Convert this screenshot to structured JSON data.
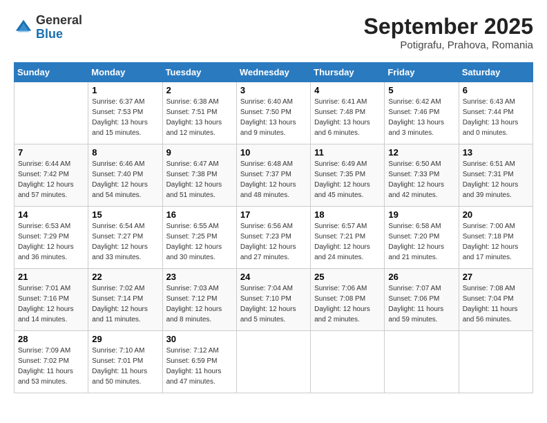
{
  "logo": {
    "general": "General",
    "blue": "Blue"
  },
  "title": "September 2025",
  "subtitle": "Potigrafu, Prahova, Romania",
  "days_header": [
    "Sunday",
    "Monday",
    "Tuesday",
    "Wednesday",
    "Thursday",
    "Friday",
    "Saturday"
  ],
  "weeks": [
    [
      {
        "day": "",
        "sunrise": "",
        "sunset": "",
        "daylight": ""
      },
      {
        "day": "1",
        "sunrise": "Sunrise: 6:37 AM",
        "sunset": "Sunset: 7:53 PM",
        "daylight": "Daylight: 13 hours and 15 minutes."
      },
      {
        "day": "2",
        "sunrise": "Sunrise: 6:38 AM",
        "sunset": "Sunset: 7:51 PM",
        "daylight": "Daylight: 13 hours and 12 minutes."
      },
      {
        "day": "3",
        "sunrise": "Sunrise: 6:40 AM",
        "sunset": "Sunset: 7:50 PM",
        "daylight": "Daylight: 13 hours and 9 minutes."
      },
      {
        "day": "4",
        "sunrise": "Sunrise: 6:41 AM",
        "sunset": "Sunset: 7:48 PM",
        "daylight": "Daylight: 13 hours and 6 minutes."
      },
      {
        "day": "5",
        "sunrise": "Sunrise: 6:42 AM",
        "sunset": "Sunset: 7:46 PM",
        "daylight": "Daylight: 13 hours and 3 minutes."
      },
      {
        "day": "6",
        "sunrise": "Sunrise: 6:43 AM",
        "sunset": "Sunset: 7:44 PM",
        "daylight": "Daylight: 13 hours and 0 minutes."
      }
    ],
    [
      {
        "day": "7",
        "sunrise": "Sunrise: 6:44 AM",
        "sunset": "Sunset: 7:42 PM",
        "daylight": "Daylight: 12 hours and 57 minutes."
      },
      {
        "day": "8",
        "sunrise": "Sunrise: 6:46 AM",
        "sunset": "Sunset: 7:40 PM",
        "daylight": "Daylight: 12 hours and 54 minutes."
      },
      {
        "day": "9",
        "sunrise": "Sunrise: 6:47 AM",
        "sunset": "Sunset: 7:38 PM",
        "daylight": "Daylight: 12 hours and 51 minutes."
      },
      {
        "day": "10",
        "sunrise": "Sunrise: 6:48 AM",
        "sunset": "Sunset: 7:37 PM",
        "daylight": "Daylight: 12 hours and 48 minutes."
      },
      {
        "day": "11",
        "sunrise": "Sunrise: 6:49 AM",
        "sunset": "Sunset: 7:35 PM",
        "daylight": "Daylight: 12 hours and 45 minutes."
      },
      {
        "day": "12",
        "sunrise": "Sunrise: 6:50 AM",
        "sunset": "Sunset: 7:33 PM",
        "daylight": "Daylight: 12 hours and 42 minutes."
      },
      {
        "day": "13",
        "sunrise": "Sunrise: 6:51 AM",
        "sunset": "Sunset: 7:31 PM",
        "daylight": "Daylight: 12 hours and 39 minutes."
      }
    ],
    [
      {
        "day": "14",
        "sunrise": "Sunrise: 6:53 AM",
        "sunset": "Sunset: 7:29 PM",
        "daylight": "Daylight: 12 hours and 36 minutes."
      },
      {
        "day": "15",
        "sunrise": "Sunrise: 6:54 AM",
        "sunset": "Sunset: 7:27 PM",
        "daylight": "Daylight: 12 hours and 33 minutes."
      },
      {
        "day": "16",
        "sunrise": "Sunrise: 6:55 AM",
        "sunset": "Sunset: 7:25 PM",
        "daylight": "Daylight: 12 hours and 30 minutes."
      },
      {
        "day": "17",
        "sunrise": "Sunrise: 6:56 AM",
        "sunset": "Sunset: 7:23 PM",
        "daylight": "Daylight: 12 hours and 27 minutes."
      },
      {
        "day": "18",
        "sunrise": "Sunrise: 6:57 AM",
        "sunset": "Sunset: 7:21 PM",
        "daylight": "Daylight: 12 hours and 24 minutes."
      },
      {
        "day": "19",
        "sunrise": "Sunrise: 6:58 AM",
        "sunset": "Sunset: 7:20 PM",
        "daylight": "Daylight: 12 hours and 21 minutes."
      },
      {
        "day": "20",
        "sunrise": "Sunrise: 7:00 AM",
        "sunset": "Sunset: 7:18 PM",
        "daylight": "Daylight: 12 hours and 17 minutes."
      }
    ],
    [
      {
        "day": "21",
        "sunrise": "Sunrise: 7:01 AM",
        "sunset": "Sunset: 7:16 PM",
        "daylight": "Daylight: 12 hours and 14 minutes."
      },
      {
        "day": "22",
        "sunrise": "Sunrise: 7:02 AM",
        "sunset": "Sunset: 7:14 PM",
        "daylight": "Daylight: 12 hours and 11 minutes."
      },
      {
        "day": "23",
        "sunrise": "Sunrise: 7:03 AM",
        "sunset": "Sunset: 7:12 PM",
        "daylight": "Daylight: 12 hours and 8 minutes."
      },
      {
        "day": "24",
        "sunrise": "Sunrise: 7:04 AM",
        "sunset": "Sunset: 7:10 PM",
        "daylight": "Daylight: 12 hours and 5 minutes."
      },
      {
        "day": "25",
        "sunrise": "Sunrise: 7:06 AM",
        "sunset": "Sunset: 7:08 PM",
        "daylight": "Daylight: 12 hours and 2 minutes."
      },
      {
        "day": "26",
        "sunrise": "Sunrise: 7:07 AM",
        "sunset": "Sunset: 7:06 PM",
        "daylight": "Daylight: 11 hours and 59 minutes."
      },
      {
        "day": "27",
        "sunrise": "Sunrise: 7:08 AM",
        "sunset": "Sunset: 7:04 PM",
        "daylight": "Daylight: 11 hours and 56 minutes."
      }
    ],
    [
      {
        "day": "28",
        "sunrise": "Sunrise: 7:09 AM",
        "sunset": "Sunset: 7:02 PM",
        "daylight": "Daylight: 11 hours and 53 minutes."
      },
      {
        "day": "29",
        "sunrise": "Sunrise: 7:10 AM",
        "sunset": "Sunset: 7:01 PM",
        "daylight": "Daylight: 11 hours and 50 minutes."
      },
      {
        "day": "30",
        "sunrise": "Sunrise: 7:12 AM",
        "sunset": "Sunset: 6:59 PM",
        "daylight": "Daylight: 11 hours and 47 minutes."
      },
      {
        "day": "",
        "sunrise": "",
        "sunset": "",
        "daylight": ""
      },
      {
        "day": "",
        "sunrise": "",
        "sunset": "",
        "daylight": ""
      },
      {
        "day": "",
        "sunrise": "",
        "sunset": "",
        "daylight": ""
      },
      {
        "day": "",
        "sunrise": "",
        "sunset": "",
        "daylight": ""
      }
    ]
  ]
}
